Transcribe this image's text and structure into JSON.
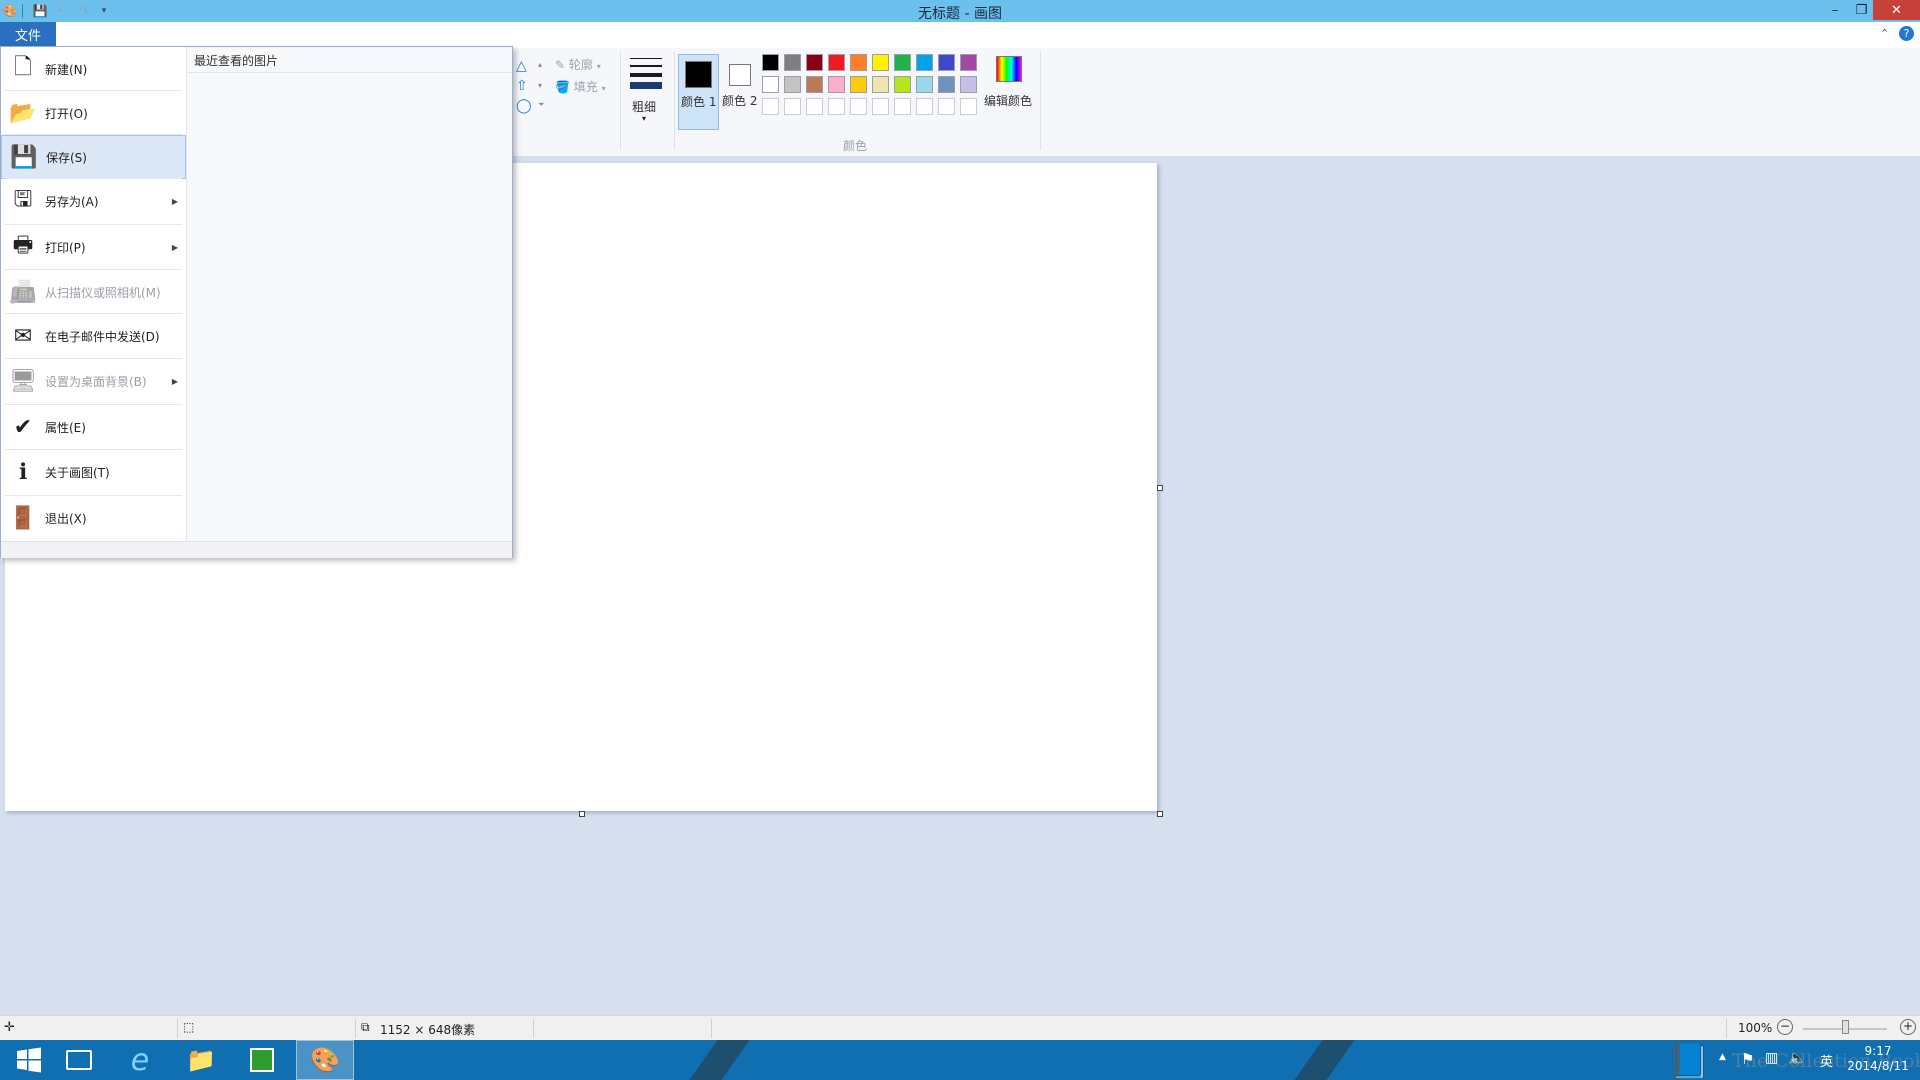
{
  "window": {
    "title": "无标题 - 画图",
    "min": "–",
    "restore": "❐",
    "close": "✕"
  },
  "ribbon": {
    "file_tab": "文件",
    "outline_label": "轮廓",
    "fill_label": "填充",
    "size_label": "粗细",
    "color1_label": "颜色 1",
    "color2_label": "颜色 2",
    "edit_colors_label": "编辑颜色",
    "colors_group_label": "颜色",
    "color1": "#000000",
    "color2": "#ffffff",
    "palette_row1": [
      "#000000",
      "#7f7f7f",
      "#880015",
      "#ed1c24",
      "#ff7f27",
      "#fff200",
      "#22b14c",
      "#00a2e8",
      "#3f48cc",
      "#a349a4"
    ],
    "palette_row2": [
      "#ffffff",
      "#c3c3c3",
      "#b97a57",
      "#ffaec9",
      "#ffc90e",
      "#efe4b0",
      "#b5e61d",
      "#99d9ea",
      "#7092be",
      "#c8bfe7"
    ],
    "palette_row3": [
      "#ffffff",
      "#ffffff",
      "#ffffff",
      "#ffffff",
      "#ffffff",
      "#ffffff",
      "#ffffff",
      "#ffffff",
      "#ffffff",
      "#ffffff"
    ]
  },
  "file_menu": {
    "items": [
      {
        "label": "新建(N)",
        "icon": "new-file-icon",
        "glyph": "🗋",
        "disabled": false,
        "submenu": false
      },
      {
        "label": "打开(O)",
        "icon": "open-folder-icon",
        "glyph": "📂",
        "disabled": false,
        "submenu": false
      },
      {
        "label": "保存(S)",
        "icon": "save-floppy-icon",
        "glyph": "💾",
        "disabled": false,
        "submenu": false
      },
      {
        "label": "另存为(A)",
        "icon": "save-as-icon",
        "glyph": "🖫",
        "disabled": false,
        "submenu": true
      },
      {
        "label": "打印(P)",
        "icon": "printer-icon",
        "glyph": "🖶",
        "disabled": false,
        "submenu": true
      },
      {
        "label": "从扫描仪或照相机(M)",
        "icon": "scanner-icon",
        "glyph": "📠",
        "disabled": true,
        "submenu": false
      },
      {
        "label": "在电子邮件中发送(D)",
        "icon": "email-icon",
        "glyph": "✉",
        "disabled": false,
        "submenu": false
      },
      {
        "label": "设置为桌面背景(B)",
        "icon": "desktop-background-icon",
        "glyph": "🖥",
        "disabled": true,
        "submenu": true
      },
      {
        "label": "属性(E)",
        "icon": "properties-check-icon",
        "glyph": "✔",
        "disabled": false,
        "submenu": false
      },
      {
        "label": "关于画图(T)",
        "icon": "info-icon",
        "glyph": "ℹ",
        "disabled": false,
        "submenu": false
      },
      {
        "label": "退出(X)",
        "icon": "exit-icon",
        "glyph": "🚪",
        "disabled": false,
        "submenu": false
      }
    ],
    "active_index": 2,
    "recent_header": "最近查看的图片"
  },
  "statusbar": {
    "image_size": "1152 × 648像素",
    "zoom": "100%"
  },
  "taskbar": {
    "clock_time": "9:17",
    "clock_date": "2014/8/11",
    "ime": "英",
    "watermark": "The Collection Book"
  }
}
